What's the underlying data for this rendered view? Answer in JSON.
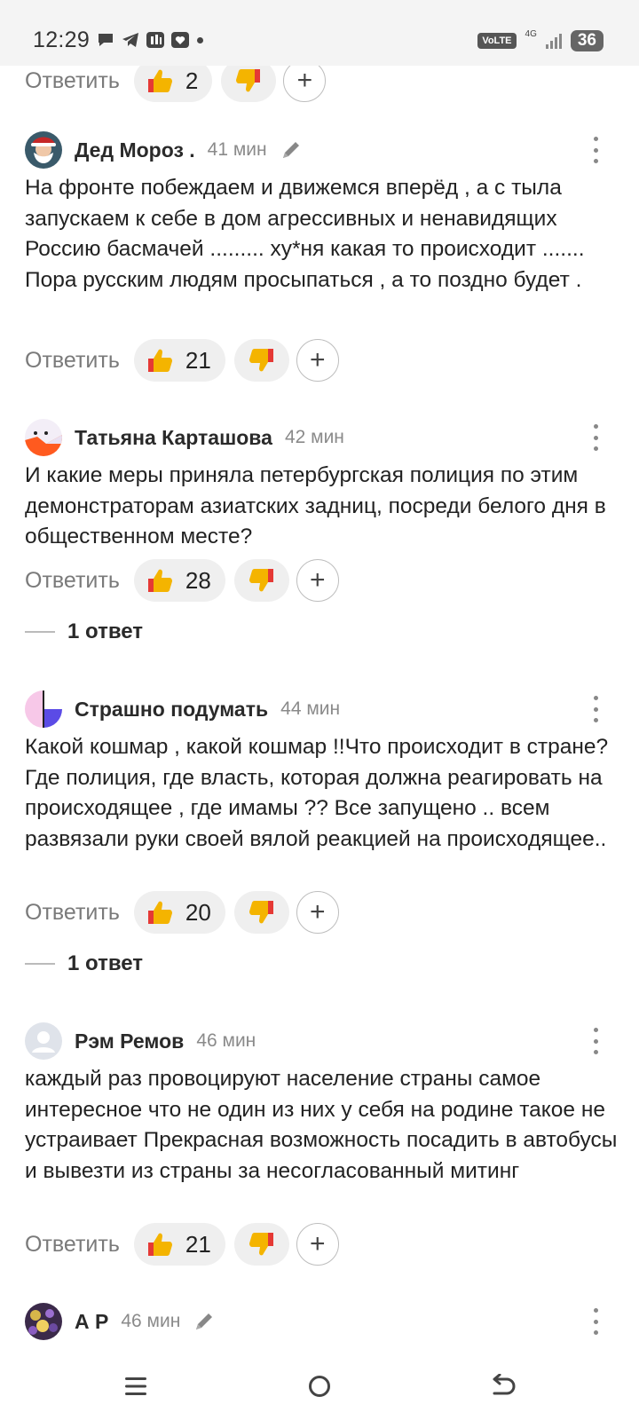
{
  "status_bar": {
    "time": "12:29",
    "volte": "VoLTE",
    "network": "4G",
    "battery": "36"
  },
  "top_actions": {
    "reply": "Ответить",
    "likes": "2"
  },
  "comments": [
    {
      "author": "Дед Мороз .",
      "time": "41 мин",
      "edited": true,
      "text": "На фронте побеждаем и движемся вперёд , а с тыла запускаем к себе в дом агрессивных и ненавидящих Россию басмачей ......... ху*ня какая то происходит ....... Пора русским людям просыпаться , а то поздно будет .",
      "reply": "Ответить",
      "likes": "21"
    },
    {
      "author": "Татьяна Карташова",
      "time": "42 мин",
      "text": "И какие меры приняла петербургская полиция по этим демонстраторам азиатских задниц, посреди белого дня в общественном месте?",
      "reply": "Ответить",
      "likes": "28",
      "replies": "1 ответ"
    },
    {
      "author": "Страшно подумать",
      "time": "44 мин",
      "text": "Какой кошмар , какой кошмар !!Что происходит в стране? Где полиция, где власть, которая должна реагировать на происходящее , где имамы ?? Все запущено .. всем развязали руки своей вялой реакцией на происходящее..",
      "reply": "Ответить",
      "likes": "20",
      "replies": "1 ответ"
    },
    {
      "author": "Рэм Ремов",
      "time": "46 мин",
      "text": "каждый раз провоцируют население страны самое интересное что не один из них у себя на родине такое не устраивает Прекрасная возможность посадить в автобусы и вывезти из страны за несогласованный митинг",
      "reply": "Ответить",
      "likes": "21"
    },
    {
      "author": "А Р",
      "time": "46 мин",
      "edited": true
    }
  ],
  "colors": {
    "like_yellow": "#f4b400",
    "dislike_red": "#e53935",
    "pill_bg": "#efefef"
  }
}
